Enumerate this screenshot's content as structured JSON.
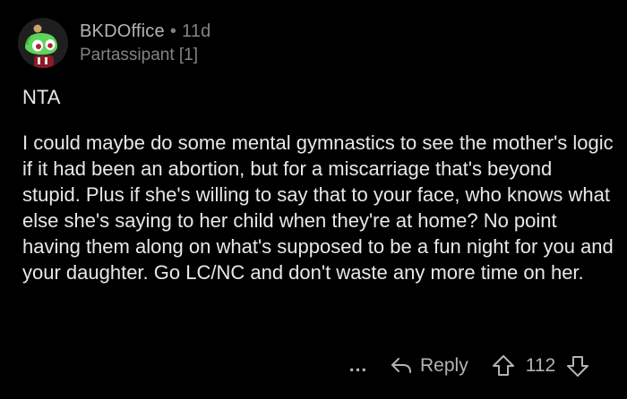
{
  "comment": {
    "username": "BKDOffice",
    "separator": "•",
    "age": "11d",
    "flair": "Partassipant [1]",
    "first_line": "NTA",
    "body": "I could maybe do some mental gymnastics to see the mother's logic if it had been an abortion, but for a miscarriage that's beyond stupid. Plus if she's willing to say that to your face, who knows what else she's saying to her child when they're at home? No point having them along on what's supposed to be a fun night for you and your daughter. Go LC/NC and don't waste any more time on her.",
    "avatar_icon": "snoo-avatar-icon"
  },
  "actions": {
    "more_label": "...",
    "reply_label": "Reply",
    "score": "112"
  }
}
